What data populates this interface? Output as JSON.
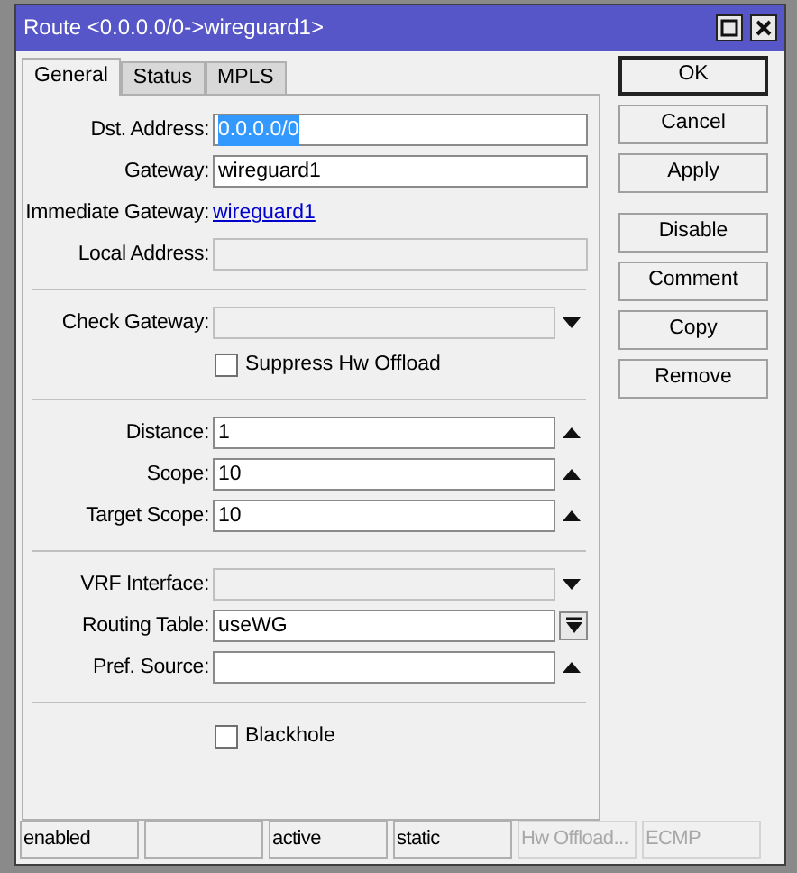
{
  "window": {
    "title": "Route <0.0.0.0/0->wireguard1>"
  },
  "tabs": [
    {
      "label": "General",
      "selected": true
    },
    {
      "label": "Status",
      "selected": false
    },
    {
      "label": "MPLS",
      "selected": false
    }
  ],
  "form": [
    {
      "kind": "field",
      "label": "Dst. Address:",
      "value": "0.0.0.0/0",
      "disabled": false,
      "selected": true
    },
    {
      "kind": "field",
      "label": "Gateway:",
      "value": "wireguard1",
      "disabled": false,
      "selected": false
    },
    {
      "kind": "link",
      "label": "Immediate Gateway:",
      "value": "wireguard1"
    },
    {
      "kind": "field",
      "label": "Local Address:",
      "disabled": true
    },
    {
      "kind": "separator"
    },
    {
      "kind": "dropdown",
      "label": "Check Gateway:",
      "disabled": true
    },
    {
      "kind": "checkbox",
      "label": "Suppress Hw Offload",
      "checked": false
    },
    {
      "kind": "separator"
    },
    {
      "kind": "spinner",
      "label": "Distance:",
      "value": "1",
      "disabled": false,
      "selected": false
    },
    {
      "kind": "spinner",
      "label": "Scope:",
      "value": "10",
      "disabled": false,
      "selected": false
    },
    {
      "kind": "spinner",
      "label": "Target Scope:",
      "value": "10",
      "disabled": false,
      "selected": false
    },
    {
      "kind": "separator"
    },
    {
      "kind": "dropdown",
      "label": "VRF Interface:",
      "disabled": true
    },
    {
      "kind": "combo",
      "label": "Routing Table:",
      "value": "useWG",
      "disabled": false,
      "selected": false
    },
    {
      "kind": "spinner",
      "label": "Pref. Source:",
      "disabled": false
    },
    {
      "kind": "separator"
    },
    {
      "kind": "checkbox",
      "label": "Blackhole",
      "checked": false
    }
  ],
  "buttons": [
    {
      "label": "OK",
      "default": true
    },
    {
      "label": "Cancel",
      "default": false
    },
    {
      "label": "Apply",
      "default": false
    }
  ],
  "actions": [
    {
      "label": "Disable",
      "default": false
    },
    {
      "label": "Comment",
      "default": false
    },
    {
      "label": "Copy",
      "default": false
    },
    {
      "label": "Remove",
      "default": false
    }
  ],
  "status_bar": [
    {
      "text": "enabled",
      "disabled": false
    },
    {
      "disabled": false
    },
    {
      "text": "active",
      "disabled": false
    },
    {
      "text": "static",
      "disabled": false
    },
    {
      "text": "Hw Offload...",
      "disabled": true
    },
    {
      "text": "ECMP",
      "disabled": true
    }
  ]
}
